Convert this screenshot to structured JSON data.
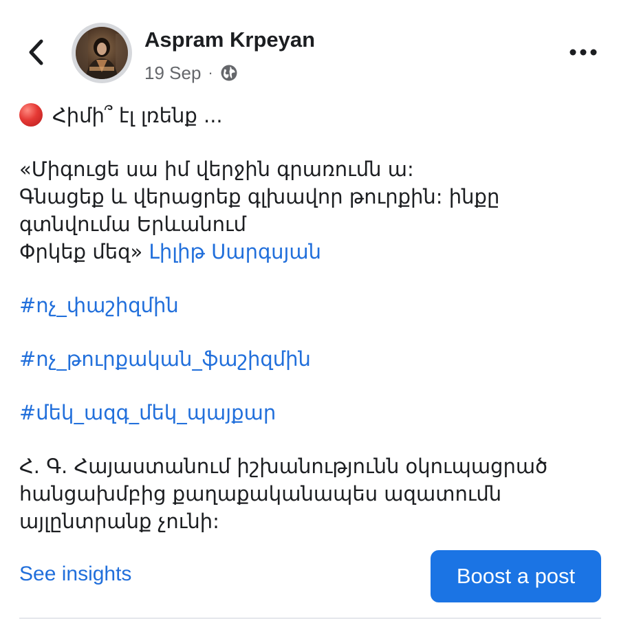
{
  "post": {
    "author": {
      "name": "Aspram Krpeyan"
    },
    "meta": {
      "date": "19 Sep",
      "separator": "·",
      "audience_icon": "globe-icon"
    },
    "intro": "Հիմի՞ էլ լռենք ...",
    "quote_lines": [
      "«Միգուցե սա իմ վերջին գրառումն ա:",
      "Գնացեք և վերացրեք գլխավոր թուրքին: ինքը",
      "գտնվումա Երևանում",
      "Փրկեք մեզ»"
    ],
    "mention": "Լիլիթ Սարգսյան",
    "hashtags": [
      "#ոչ_փաշիզմին",
      "#ոչ_թուրքական_ֆաշիզմին",
      "#մեկ_ազգ_մեկ_պայքար"
    ],
    "closing_lines": [
      "Հ. Գ. Հայաստանում իշխանությունն օկուպացրած",
      "հանցախմբից քաղաքականապես ազատումն",
      "այլընտրանք չունի:"
    ]
  },
  "actions": {
    "insights_label": "See insights",
    "boost_label": "Boost a post"
  },
  "colors": {
    "link": "#216fdb",
    "boost_button": "#1b74e4",
    "meta_text": "#65676b",
    "text": "#1c1e21"
  }
}
